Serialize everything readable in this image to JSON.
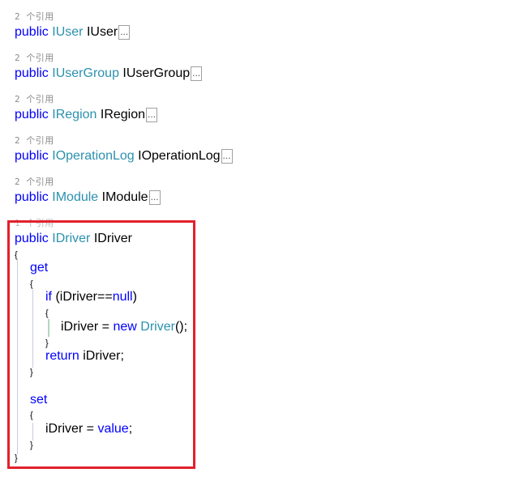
{
  "editor": {
    "properties": [
      {
        "references": "2 个引用",
        "keyword": "public",
        "type": "IUser",
        "name": "IUser",
        "collapsed": "..."
      },
      {
        "references": "2 个引用",
        "keyword": "public",
        "type": "IUserGroup",
        "name": "IUserGroup",
        "collapsed": "..."
      },
      {
        "references": "2 个引用",
        "keyword": "public",
        "type": "IRegion",
        "name": "IRegion",
        "collapsed": "..."
      },
      {
        "references": "2 个引用",
        "keyword": "public",
        "type": "IOperationLog",
        "name": "IOperationLog",
        "collapsed": "..."
      },
      {
        "references": "2 个引用",
        "keyword": "public",
        "type": "IModule",
        "name": "IModule",
        "collapsed": "..."
      }
    ],
    "expanded": {
      "references": "1 个引用",
      "keyword": "public",
      "type": "IDriver",
      "name": "IDriver",
      "open_brace": "{",
      "close_brace": "}",
      "get_keyword": "get",
      "if_keyword": "if",
      "if_condition_pre": " (iDriver==",
      "null_keyword": "null",
      "if_condition_post": ")",
      "assign_pre": "iDriver = ",
      "new_keyword": "new",
      "driver_type": "Driver",
      "assign_post": "();",
      "return_keyword": "return",
      "return_expr": " iDriver;",
      "set_keyword": "set",
      "set_assign_pre": "iDriver = ",
      "value_keyword": "value",
      "set_assign_post": ";"
    },
    "colors": {
      "keyword": "#0000ff",
      "type": "#2b91af",
      "highlight_border": "#e2202c"
    }
  }
}
